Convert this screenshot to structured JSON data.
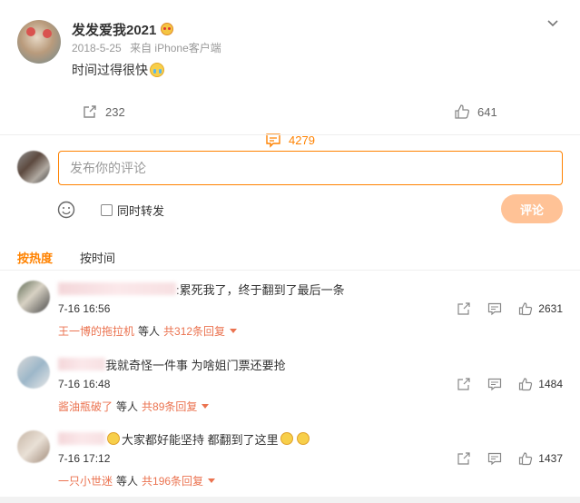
{
  "post": {
    "author": "发发爱我2021",
    "date": "2018-5-25",
    "source": "来自 iPhone客户端",
    "text": "时间过得很快"
  },
  "actions": {
    "share_count": "232",
    "comment_count": "4279",
    "like_count": "641"
  },
  "composer": {
    "placeholder": "发布你的评论",
    "repost_label": "同时转发",
    "submit_label": "评论"
  },
  "sort_tabs": {
    "hot_label": "按热度",
    "time_label": "按时间"
  },
  "comments": [
    {
      "text": ":累死我了，终于翻到了最后一条",
      "time": "7-16 16:56",
      "likes": "2631",
      "reply_user": "王一博的拖拉机",
      "reply_deng": "等人",
      "reply_total": "共312条回复"
    },
    {
      "text": "我就奇怪一件事 为啥姐门票还要抢",
      "time": "7-16 16:48",
      "likes": "1484",
      "reply_user": "酱油瓶破了",
      "reply_deng": "等人",
      "reply_total": "共89条回复"
    },
    {
      "text": "大家都好能坚持 都翻到了这里",
      "time": "7-16 17:12",
      "likes": "1437",
      "reply_user": "一只小世迷",
      "reply_deng": "等人",
      "reply_total": "共196条回复"
    }
  ],
  "colors": {
    "accent": "#ff8200",
    "reply_link": "#eb7350",
    "submit_disabled": "#ffc296"
  },
  "icons": {
    "share": "share-icon",
    "comment": "comment-icon",
    "like": "thumb-up-icon",
    "emoji": "smile-icon",
    "expand": "chevron-down-icon"
  }
}
